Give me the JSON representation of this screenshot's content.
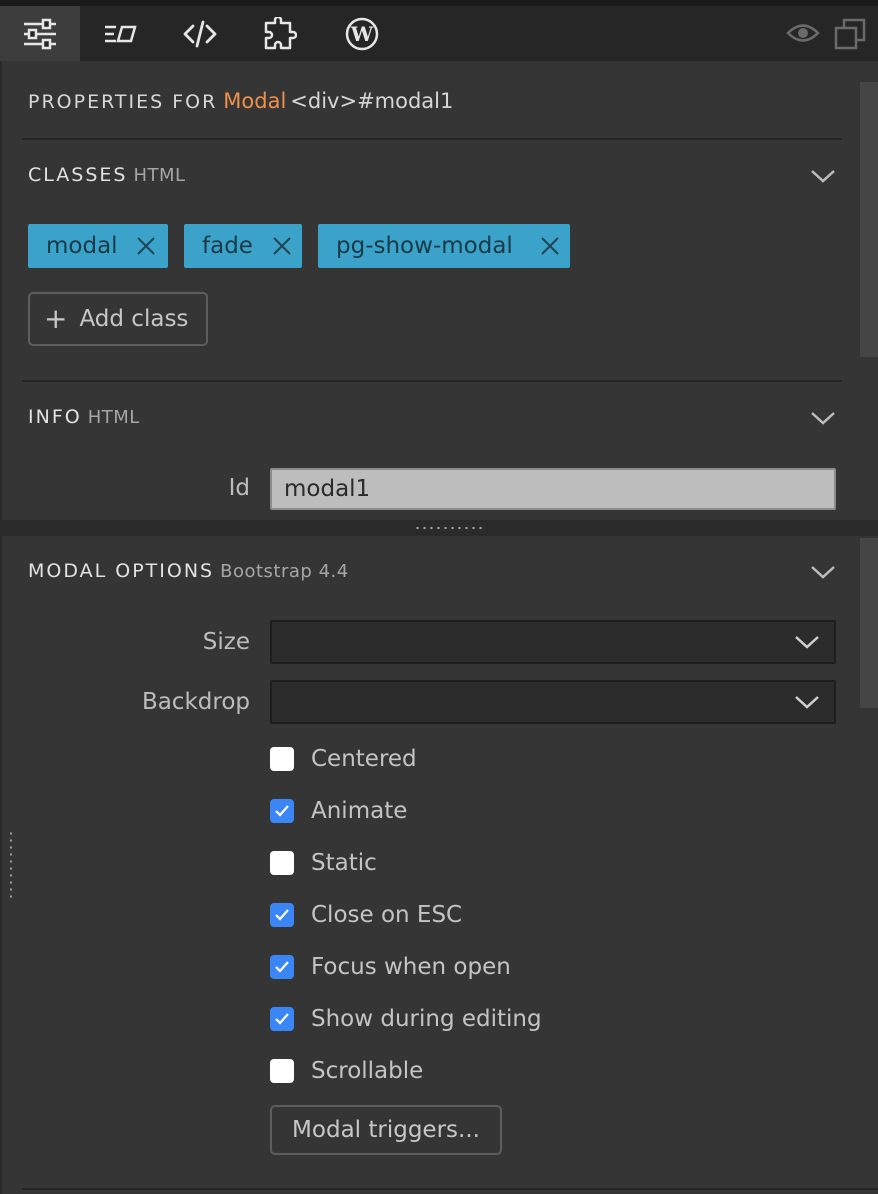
{
  "toolbar": {
    "tabs": [
      {
        "icon": "sliders-icon",
        "active": true
      },
      {
        "icon": "classes-icon",
        "active": false
      },
      {
        "icon": "code-icon",
        "active": false
      },
      {
        "icon": "puzzle-icon",
        "active": false
      },
      {
        "icon": "wordpress-icon",
        "active": false
      }
    ],
    "right_icons": [
      "eye-icon",
      "duplicate-icon"
    ]
  },
  "properties": {
    "prefix": "PROPERTIES FOR",
    "element_name": "Modal",
    "element_tag": "<div>#modal1"
  },
  "classes": {
    "title": "CLASSES",
    "subtitle": "HTML",
    "items": [
      "modal",
      "fade",
      "pg-show-modal"
    ],
    "add_label": "Add class"
  },
  "info": {
    "title": "INFO",
    "subtitle": "HTML",
    "id_label": "Id",
    "id_value": "modal1"
  },
  "modal_options": {
    "title": "MODAL OPTIONS",
    "subtitle": "Bootstrap 4.4",
    "size_label": "Size",
    "size_value": "",
    "backdrop_label": "Backdrop",
    "backdrop_value": "",
    "checkboxes": [
      {
        "label": "Centered",
        "checked": false
      },
      {
        "label": "Animate",
        "checked": true
      },
      {
        "label": "Static",
        "checked": false
      },
      {
        "label": "Close on ESC",
        "checked": true
      },
      {
        "label": "Focus when open",
        "checked": true
      },
      {
        "label": "Show during editing",
        "checked": true
      },
      {
        "label": "Scrollable",
        "checked": false
      }
    ],
    "triggers_label": "Modal triggers..."
  },
  "colors": {
    "accent": "#f0914b",
    "chip": "#3ba2c9",
    "checkbox_checked": "#3a86f6",
    "panel_bg": "#353535"
  }
}
